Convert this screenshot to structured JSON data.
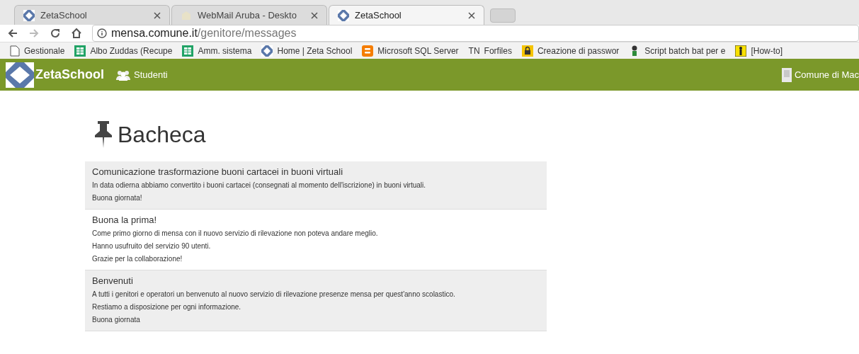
{
  "tabs": [
    {
      "title": "ZetaSchool",
      "kind": "zeta",
      "selected": false
    },
    {
      "title": "WebMail Aruba - Deskto",
      "kind": "mail",
      "selected": false
    },
    {
      "title": "ZetaSchool",
      "kind": "zeta",
      "selected": true
    }
  ],
  "address": {
    "host": "mensa.comune.it",
    "path": "/genitore/messages"
  },
  "bookmarks": [
    {
      "label": "Gestionale",
      "kind": "page"
    },
    {
      "label": "Albo Zuddas (Recupe",
      "kind": "sheet"
    },
    {
      "label": "Amm. sistema",
      "kind": "sheet"
    },
    {
      "label": "Home | Zeta School",
      "kind": "zeta"
    },
    {
      "label": "Microsoft SQL Server",
      "kind": "blogger"
    },
    {
      "label": "Forfiles",
      "kind": "text",
      "icon_text": "TN"
    },
    {
      "label": "Creazione di passwor",
      "kind": "lock"
    },
    {
      "label": "Script batch bat per e",
      "kind": "figure"
    },
    {
      "label": "[How-to]",
      "kind": "yellow"
    }
  ],
  "navbar": {
    "brand": "ZetaSchool",
    "link": "Studenti",
    "right": "Comune di Mac"
  },
  "heading": "Bacheca",
  "messages": [
    {
      "title": "Comunicazione trasformazione buoni cartacei in buoni virtuali",
      "shaded": true,
      "lines": [
        "In data odierna abbiamo convertito i buoni cartacei (consegnati al momento dell'iscrizione) in buoni virtuali.",
        "Buona giornata!"
      ]
    },
    {
      "title": "Buona la prima!",
      "shaded": false,
      "lines": [
        "Come primo giorno di mensa con il nuovo servizio di rilevazione non poteva andare meglio.",
        "Hanno usufruito del servizio 90 utenti.",
        "Grazie per la collaborazione!"
      ]
    },
    {
      "title": "Benvenuti",
      "shaded": true,
      "lines": [
        "A tutti i genitori e operatori un benvenuto al nuovo servizio di rilevazione presenze mensa per quest'anno scolastico.",
        "Restiamo a disposizione per ogni informazione.",
        "Buona giornata"
      ]
    }
  ]
}
